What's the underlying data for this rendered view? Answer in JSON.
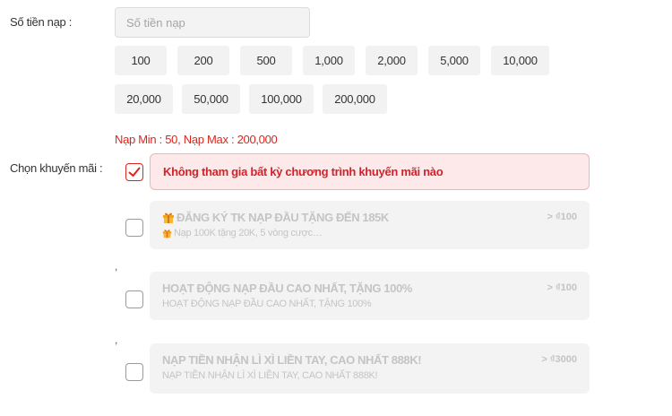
{
  "amount": {
    "label": "Số tiền nạp :",
    "placeholder": "Số tiền nạp",
    "presets_row1": [
      "100",
      "200",
      "500",
      "1,000",
      "2,000",
      "5,000",
      "10,000"
    ],
    "presets_row2": [
      "20,000",
      "50,000",
      "100,000",
      "200,000"
    ],
    "limits": "Nạp Min :  50,   Nạp Max :  200,000"
  },
  "promo": {
    "label": "Chọn khuyến mãi :",
    "selected_option": "Không tham gia bất kỳ chương trình khuyến mãi nào",
    "separator": ",",
    "items": [
      {
        "title": "ĐĂNG KÝ TK NẠP ĐẦU TẶNG ĐẾN 185K",
        "subtitle": "Nạp 100K tặng 20K, 5 vòng cược…",
        "amount": "> ₫100",
        "gift_icon": true
      },
      {
        "title": "HOẠT ĐỘNG NẠP ĐẦU CAO NHẤT, TẶNG 100%",
        "subtitle": "HOẠT ĐỘNG NẠP ĐẦU CAO NHẤT, TẶNG 100%",
        "amount": "> ₫100",
        "gift_icon": false
      },
      {
        "title": "NẠP TIỀN NHẬN LÌ XÌ LIỀN TAY, CAO NHẤT 888K!",
        "subtitle": "NẠP TIỀN NHẬN LÌ XÌ LIỀN TAY, CAO NHẤT 888K!",
        "amount": "> ₫3000",
        "gift_icon": false
      }
    ]
  },
  "colors": {
    "accent_red": "#e0241b",
    "selected_bg": "#fde9e9",
    "muted_text": "#c4c4c4",
    "gift_orange": "#f0a31c"
  }
}
